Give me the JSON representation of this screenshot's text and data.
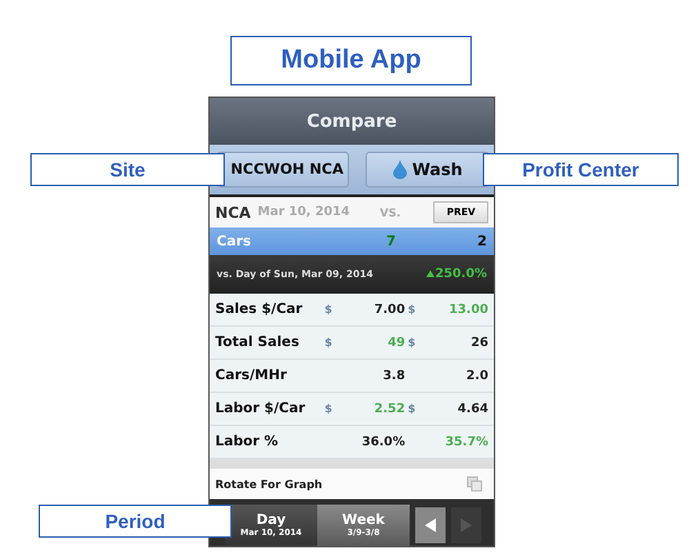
{
  "title": "Mobile App",
  "app": {
    "header": "Compare",
    "site_button": "NCCWOH NCA",
    "profit_center_button": "Wash",
    "site_name": "NCA",
    "date": "Mar 10, 2014",
    "vs": "VS.",
    "prev_button": "PREV",
    "selected_metric": {
      "label": "Cars",
      "current": "7",
      "compare": "2"
    },
    "comparison": {
      "label": "vs. Day of Sun, Mar 09, 2014",
      "change": "250.0%",
      "increase": true
    },
    "rows": [
      {
        "label": "Sales $/Car",
        "currency": "$",
        "current": "7.00",
        "current_better": false,
        "compare": "13.00",
        "compare_better": true
      },
      {
        "label": "Total Sales",
        "currency": "$",
        "current": "49",
        "current_better": true,
        "compare": "26",
        "compare_better": false
      },
      {
        "label": "Cars/MHr",
        "current": "3.8",
        "current_better": false,
        "compare": "2.0",
        "compare_better": false
      },
      {
        "label": "Labor $/Car",
        "currency": "$",
        "current": "2.52",
        "current_better": true,
        "compare": "4.64",
        "compare_better": false
      },
      {
        "label": "Labor %",
        "current": "36.0%",
        "current_better": false,
        "compare": "35.7%",
        "compare_better": true
      }
    ],
    "rotate_hint": "Rotate For Graph",
    "periods": [
      {
        "label": "Day",
        "range": "Mar 10, 2014",
        "selected": true
      },
      {
        "label": "Week",
        "range": "3/9-3/8",
        "selected": false
      }
    ],
    "prev_arrow_disabled": false,
    "next_arrow_disabled": true
  },
  "callouts": [
    {
      "label": "Site",
      "kind": "site"
    },
    {
      "label": "Profit Center",
      "kind": "profit"
    },
    {
      "label": "Period",
      "kind": "period"
    }
  ]
}
